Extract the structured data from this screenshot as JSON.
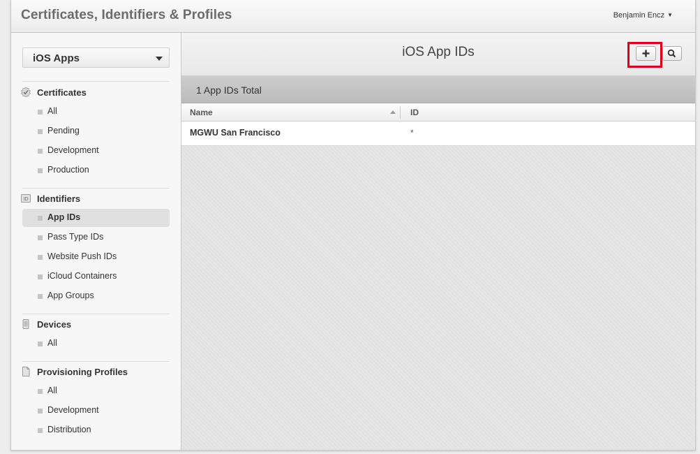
{
  "header": {
    "title": "Certificates, Identifiers & Profiles",
    "user_name": "Benjamin Encz"
  },
  "sidebar": {
    "platform_selector": "iOS Apps",
    "sections": [
      {
        "title": "Certificates",
        "icon": "certificate-icon",
        "items": [
          {
            "label": "All"
          },
          {
            "label": "Pending"
          },
          {
            "label": "Development"
          },
          {
            "label": "Production"
          }
        ]
      },
      {
        "title": "Identifiers",
        "icon": "id-badge-icon",
        "icon_text": "ID",
        "items": [
          {
            "label": "App IDs",
            "active": true
          },
          {
            "label": "Pass Type IDs"
          },
          {
            "label": "Website Push IDs"
          },
          {
            "label": "iCloud Containers"
          },
          {
            "label": "App Groups"
          }
        ]
      },
      {
        "title": "Devices",
        "icon": "device-icon",
        "items": [
          {
            "label": "All"
          }
        ]
      },
      {
        "title": "Provisioning Profiles",
        "icon": "document-icon",
        "items": [
          {
            "label": "All"
          },
          {
            "label": "Development"
          },
          {
            "label": "Distribution"
          }
        ]
      }
    ]
  },
  "main": {
    "page_title": "iOS App IDs",
    "add_icon": "plus-icon",
    "search_icon": "search-icon",
    "summary": "1 App IDs Total",
    "table": {
      "columns": [
        "Name",
        "ID"
      ],
      "rows": [
        {
          "name": "MGWU San Francisco",
          "id": "*"
        }
      ]
    }
  },
  "colors": {
    "highlight": "#e0001a",
    "active_item_bg": "#e0e0e0",
    "summary_bar": "#c4c4c4"
  }
}
